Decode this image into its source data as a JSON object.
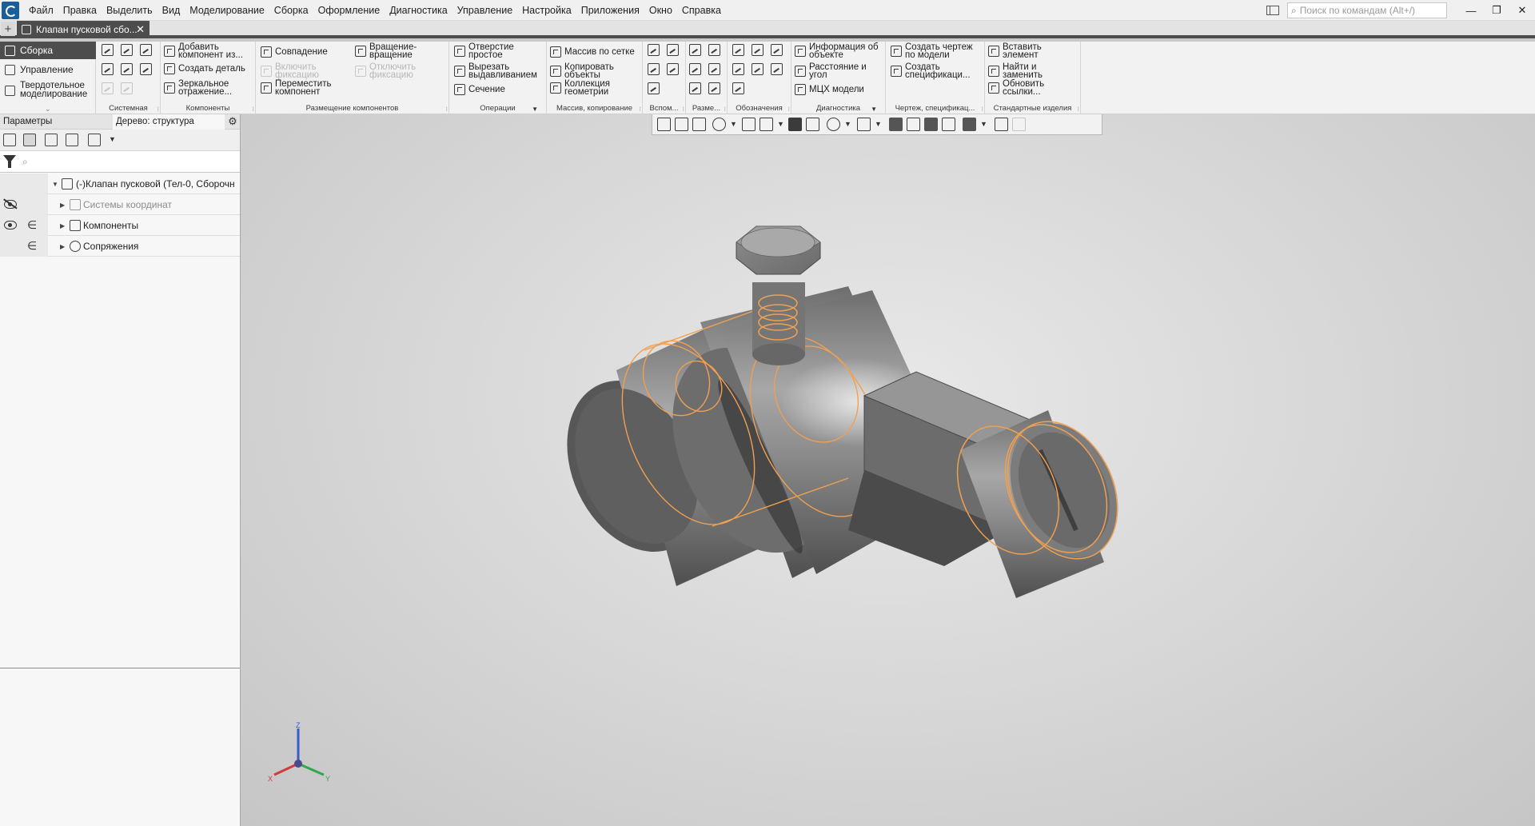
{
  "menubar": {
    "items": [
      "Файл",
      "Правка",
      "Выделить",
      "Вид",
      "Моделирование",
      "Сборка",
      "Оформление",
      "Диагностика",
      "Управление",
      "Настройка",
      "Приложения",
      "Окно",
      "Справка"
    ],
    "search_placeholder": "Поиск по командам (Alt+/)"
  },
  "window_controls": {
    "minimize": "—",
    "restore": "❐",
    "close": "✕"
  },
  "document_tab": {
    "title": "Клапан пусковой сбо...",
    "close": "✕",
    "add": "+"
  },
  "ribbon": {
    "modes": [
      "Сборка",
      "Управление",
      "Твердотельное\nмоделирование"
    ],
    "mode_more": "⌄",
    "groups": {
      "system": "Системная",
      "components": "Компоненты",
      "placement": "Размещение компонентов",
      "operations": "Операции",
      "array": "Массив, копирование",
      "aux": "Вспом...",
      "dims": "Разме...",
      "notation": "Обозначения",
      "diagnostics": "Диагностика",
      "drawing": "Чертеж, спецификац...",
      "standard": "Стандартные изделия"
    },
    "buttons": {
      "add_component": "Добавить\nкомпонент из...",
      "create_part": "Создать деталь",
      "mirror": "Зеркальное\nотражение...",
      "coincidence": "Совпадение",
      "enable_fix": "Включить\nфиксацию",
      "move_component": "Переместить\nкомпонент",
      "rotation": "Вращение-\nвращение",
      "disable_fix": "Отключить\nфиксацию",
      "hole": "Отверстие\nпростое",
      "extrude_cut": "Вырезать\nвыдавливанием",
      "section": "Сечение",
      "grid_array": "Массив по сетке",
      "copy_objects": "Копировать\nобъекты",
      "geometry_collection": "Коллекция\nгеометрии",
      "object_info": "Информация об\nобъекте",
      "distance_angle": "Расстояние и\nугол",
      "mass_props": "МЦХ модели",
      "create_drawing": "Создать чертеж\nпо модели",
      "create_spec": "Создать\nспецификаци...",
      "insert_element": "Вставить\nэлемент",
      "find_replace": "Найти и\nзаменить",
      "update_links": "Обновить\nссылки..."
    }
  },
  "left_panel": {
    "tab_params": "Параметры",
    "tab_tree": "Дерево: структура",
    "search_placeholder": "⌕",
    "tree": [
      {
        "label": "(-)Клапан пусковой (Тел-0, Сборочн",
        "level": 0,
        "expanded": true
      },
      {
        "label": "Системы координат",
        "level": 1,
        "expanded": false,
        "dim": true
      },
      {
        "label": "Компоненты",
        "level": 1,
        "expanded": false
      },
      {
        "label": "Сопряжения",
        "level": 1,
        "expanded": false
      }
    ]
  },
  "triad": {
    "z": "Z",
    "x": "X",
    "y": "Y"
  },
  "colors": {
    "accent_dark": "#4d4d4d",
    "edge_orange": "#f0a050",
    "model_gray": "#8a8a8a"
  }
}
